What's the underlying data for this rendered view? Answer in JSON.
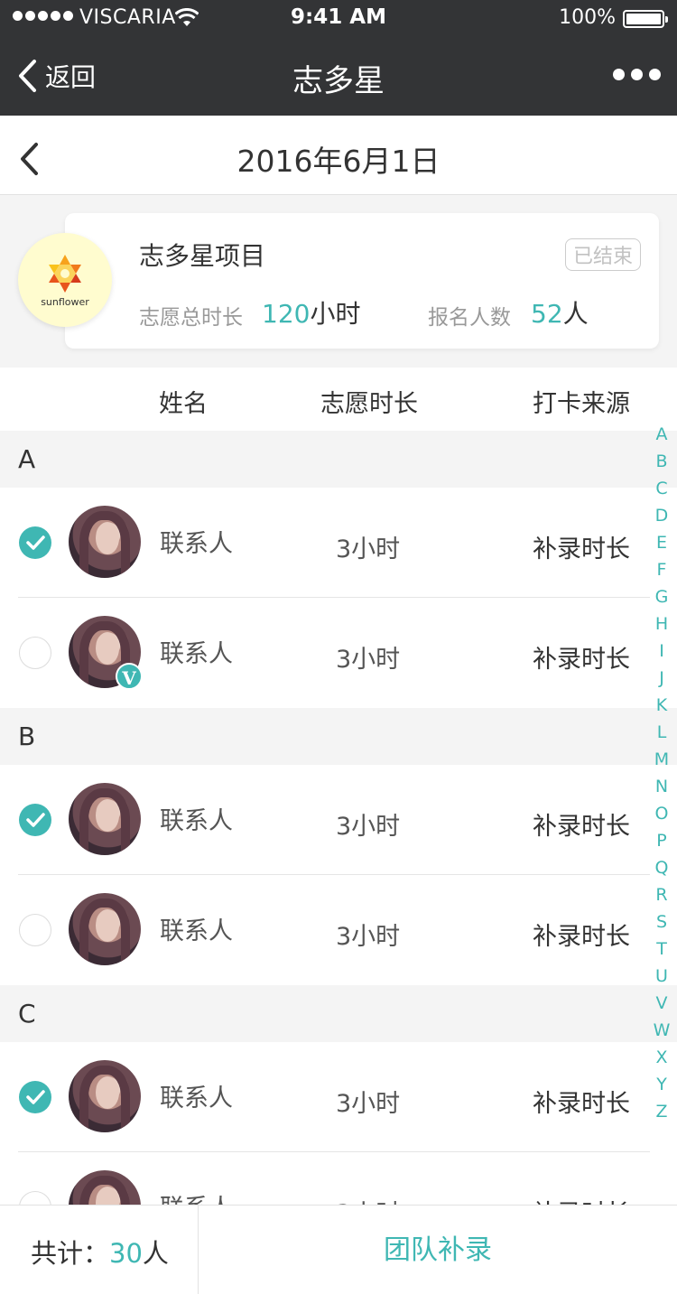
{
  "status_bar": {
    "carrier": "VISCARIA",
    "time": "9:41 AM",
    "battery": "100%"
  },
  "nav": {
    "back_label": "返回",
    "title": "志多星"
  },
  "date_bar": {
    "date": "2016年6月1日"
  },
  "project": {
    "logo_text": "sunflower",
    "name": "志多星项目",
    "status": "已结束",
    "total_hours_label": "志愿总时长",
    "total_hours_value": "120",
    "total_hours_unit": "小时",
    "signup_label": "报名人数",
    "signup_value": "52",
    "signup_unit": "人"
  },
  "list": {
    "columns": [
      "姓名",
      "志愿时长",
      "打卡来源"
    ],
    "sections": [
      {
        "letter": "A",
        "rows": [
          {
            "name": "联系人",
            "duration": "3小时",
            "source": "补录时长",
            "checked": true,
            "verified": false
          },
          {
            "name": "联系人",
            "duration": "3小时",
            "source": "补录时长",
            "checked": false,
            "verified": true
          }
        ]
      },
      {
        "letter": "B",
        "rows": [
          {
            "name": "联系人",
            "duration": "3小时",
            "source": "补录时长",
            "checked": true,
            "verified": false
          },
          {
            "name": "联系人",
            "duration": "3小时",
            "source": "补录时长",
            "checked": false,
            "verified": false
          }
        ]
      },
      {
        "letter": "C",
        "rows": [
          {
            "name": "联系人",
            "duration": "3小时",
            "source": "补录时长",
            "checked": true,
            "verified": false
          },
          {
            "name": "联系人",
            "duration": "3小时",
            "source": "补录时长",
            "checked": false,
            "verified": false
          }
        ]
      }
    ],
    "verified_badge": "V"
  },
  "index_letters": [
    "A",
    "B",
    "C",
    "D",
    "E",
    "F",
    "G",
    "H",
    "I",
    "J",
    "K",
    "L",
    "M",
    "N",
    "O",
    "P",
    "Q",
    "R",
    "S",
    "T",
    "U",
    "V",
    "W",
    "X",
    "Y",
    "Z"
  ],
  "bottom": {
    "total_label": "共计：",
    "total_value": "30",
    "total_unit": "人",
    "team_button": "团队补录"
  },
  "colors": {
    "accent": "#3fb7b3",
    "nav_bg": "#333436",
    "logo_bg": "#fffccf"
  }
}
